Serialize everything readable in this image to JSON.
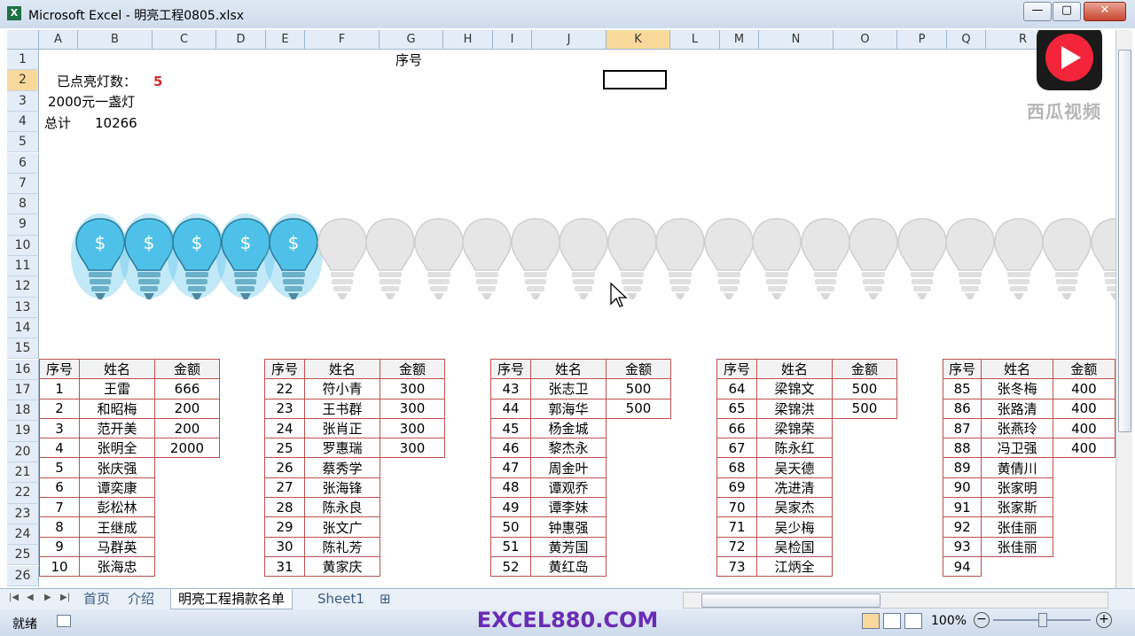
{
  "window": {
    "title": "Microsoft Excel - 明亮工程0805.xlsx",
    "min_label": "—",
    "max_label": "▢",
    "close_label": "✕"
  },
  "sheet": {
    "columns": [
      "A",
      "B",
      "C",
      "D",
      "E",
      "F",
      "G",
      "H",
      "I",
      "J",
      "K",
      "L",
      "M",
      "N",
      "O",
      "P",
      "Q",
      "R"
    ],
    "selected_column": "K",
    "rows": [
      "1",
      "2",
      "3",
      "4",
      "5",
      "6",
      "7",
      "8",
      "9",
      "10",
      "11",
      "12",
      "13",
      "14",
      "15",
      "16",
      "17",
      "18",
      "19",
      "20",
      "21",
      "22",
      "23",
      "24",
      "25",
      "26"
    ],
    "selected_row": "2",
    "g1": "序号",
    "a2_label": "已点亮灯数：",
    "a2_value": "5",
    "a3": "2000元一盏灯",
    "a4_label": "总计",
    "a4_value": "10266",
    "lit_count": 5,
    "bulb_total": 22
  },
  "tables": [
    {
      "headers": [
        "序号",
        "姓名",
        "金额"
      ],
      "rows": [
        [
          "1",
          "王雷",
          "666"
        ],
        [
          "2",
          "和昭梅",
          "200"
        ],
        [
          "3",
          "范开美",
          "200"
        ],
        [
          "4",
          "张明全",
          "2000"
        ],
        [
          "5",
          "张庆强",
          ""
        ],
        [
          "6",
          "谭奕康",
          ""
        ],
        [
          "7",
          "彭松林",
          ""
        ],
        [
          "8",
          "王继成",
          ""
        ],
        [
          "9",
          "马群英",
          ""
        ],
        [
          "10",
          "张海忠",
          ""
        ]
      ]
    },
    {
      "headers": [
        "序号",
        "姓名",
        "金额"
      ],
      "rows": [
        [
          "22",
          "符小青",
          "300"
        ],
        [
          "23",
          "王书群",
          "300"
        ],
        [
          "24",
          "张肖正",
          "300"
        ],
        [
          "25",
          "罗惠瑞",
          "300"
        ],
        [
          "26",
          "蔡秀学",
          ""
        ],
        [
          "27",
          "张海锋",
          ""
        ],
        [
          "28",
          "陈永良",
          ""
        ],
        [
          "29",
          "张文广",
          ""
        ],
        [
          "30",
          "陈礼芳",
          ""
        ],
        [
          "31",
          "黄家庆",
          ""
        ]
      ]
    },
    {
      "headers": [
        "序号",
        "姓名",
        "金额"
      ],
      "rows": [
        [
          "43",
          "张志卫",
          "500"
        ],
        [
          "44",
          "郭海华",
          "500"
        ],
        [
          "45",
          "杨金城",
          ""
        ],
        [
          "46",
          "黎杰永",
          ""
        ],
        [
          "47",
          "周金叶",
          ""
        ],
        [
          "48",
          "谭观乔",
          ""
        ],
        [
          "49",
          "谭李妹",
          ""
        ],
        [
          "50",
          "钟惠强",
          ""
        ],
        [
          "51",
          "黄芳国",
          ""
        ],
        [
          "52",
          "黄红岛",
          ""
        ]
      ]
    },
    {
      "headers": [
        "序号",
        "姓名",
        "金额"
      ],
      "rows": [
        [
          "64",
          "梁锦文",
          "500"
        ],
        [
          "65",
          "梁锦洪",
          "500"
        ],
        [
          "66",
          "梁锦荣",
          ""
        ],
        [
          "67",
          "陈永红",
          ""
        ],
        [
          "68",
          "吴天德",
          ""
        ],
        [
          "69",
          "冼进清",
          ""
        ],
        [
          "70",
          "吴家杰",
          ""
        ],
        [
          "71",
          "吴少梅",
          ""
        ],
        [
          "72",
          "吴检国",
          ""
        ],
        [
          "73",
          "江炳全",
          ""
        ]
      ]
    },
    {
      "headers": [
        "序号",
        "姓名",
        "金额"
      ],
      "rows": [
        [
          "85",
          "张冬梅",
          "400"
        ],
        [
          "86",
          "张路清",
          "400"
        ],
        [
          "87",
          "张燕玲",
          "400"
        ],
        [
          "88",
          "冯卫强",
          "400"
        ],
        [
          "89",
          "黄倩川",
          ""
        ],
        [
          "90",
          "张家明",
          ""
        ],
        [
          "91",
          "张家斯",
          ""
        ],
        [
          "92",
          "张佳丽",
          ""
        ],
        [
          "93",
          "张佳丽",
          ""
        ],
        [
          "94",
          "",
          ""
        ]
      ]
    }
  ],
  "sheet_tabs": [
    "首页",
    "介绍",
    "明亮工程捐款名单",
    "Sheet1"
  ],
  "active_tab": "明亮工程捐款名单",
  "status": {
    "ready": "就绪",
    "zoom": "100%"
  },
  "watermark": {
    "site": "EXCEL880.COM",
    "logo_text": "西瓜视频"
  },
  "colors": {
    "lit": "#4fc1e9",
    "unlit": "#e6e6e6",
    "accent_red": "#d92b2b",
    "table_border": "#c0504d",
    "watermark": "#6a2bb5"
  }
}
